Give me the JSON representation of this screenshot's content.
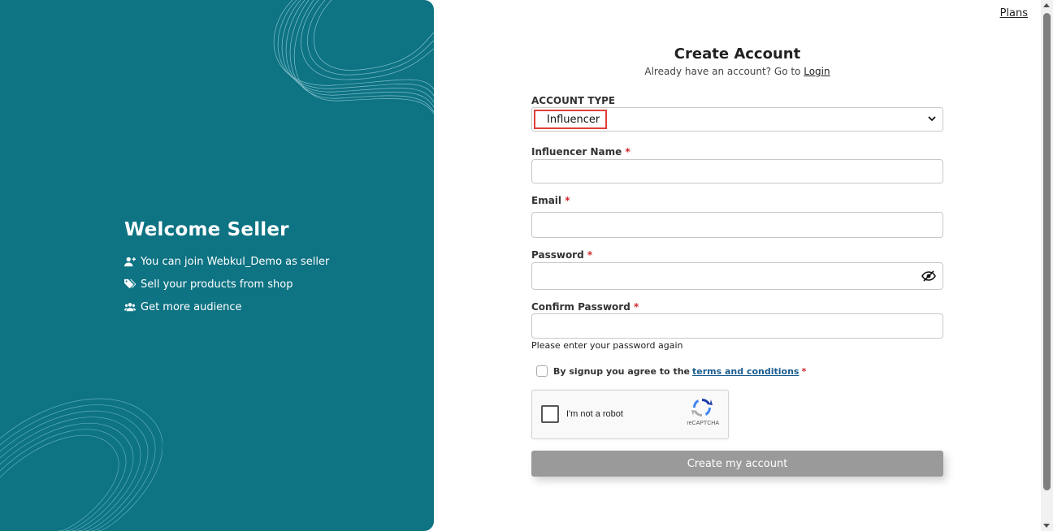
{
  "nav": {
    "plans_label": "Plans"
  },
  "welcome": {
    "title": "Welcome Seller",
    "features": [
      {
        "icon": "user-plus-icon",
        "text": "You can join Webkul_Demo as seller"
      },
      {
        "icon": "tags-icon",
        "text": "Sell your products from shop"
      },
      {
        "icon": "users-icon",
        "text": "Get more audience"
      }
    ]
  },
  "form": {
    "title": "Create Account",
    "subtitle_prefix": "Already have an account? Go to ",
    "login_label": "Login",
    "account_type": {
      "label": "ACCOUNT TYPE",
      "value": "Influencer"
    },
    "influencer_name": {
      "label": "Influencer Name",
      "value": ""
    },
    "email": {
      "label": "Email",
      "value": ""
    },
    "password": {
      "label": "Password",
      "value": ""
    },
    "confirm_password": {
      "label": "Confirm Password",
      "value": "",
      "hint": "Please enter your password again"
    },
    "required_mark": "*",
    "terms": {
      "prefix": "By signup you agree to the",
      "link": "terms and conditions"
    },
    "recaptcha": {
      "label": "I'm not a robot",
      "brand": "reCAPTCHA"
    },
    "submit_label": "Create my account"
  },
  "colors": {
    "panel": "#0e7383",
    "required": "#d0282e",
    "link": "#1a5d8e",
    "button": "#9a9a9a",
    "highlight": "#e0403a"
  }
}
